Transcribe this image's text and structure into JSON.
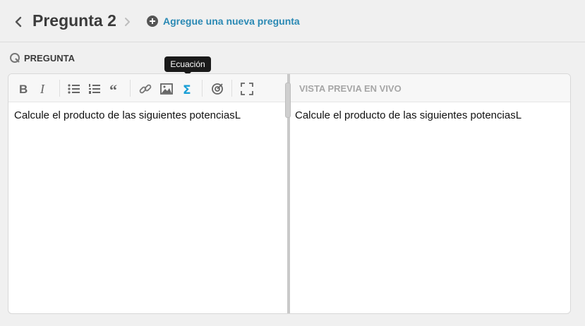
{
  "header": {
    "title": "Pregunta 2",
    "add_question_label": "Agregue una nueva pregunta"
  },
  "section": {
    "label": "PREGUNTA"
  },
  "toolbar": {
    "tooltip": "Ecuación",
    "buttons": [
      "bold-icon",
      "italic-icon",
      "bulleted-list-icon",
      "numbered-list-icon",
      "quote-icon",
      "link-icon",
      "image-icon",
      "equation-icon",
      "target-icon",
      "fullscreen-icon"
    ],
    "active_button": "equation-icon"
  },
  "editor": {
    "content": "Calcule el producto de las siguientes potenciasL"
  },
  "preview": {
    "label": "VISTA PREVIA EN VIVO",
    "content": "Calcule el producto de las siguientes potenciasL"
  },
  "colors": {
    "accent": "#2a89b4",
    "equation_active": "#1a9fd6",
    "icon": "#666666"
  }
}
